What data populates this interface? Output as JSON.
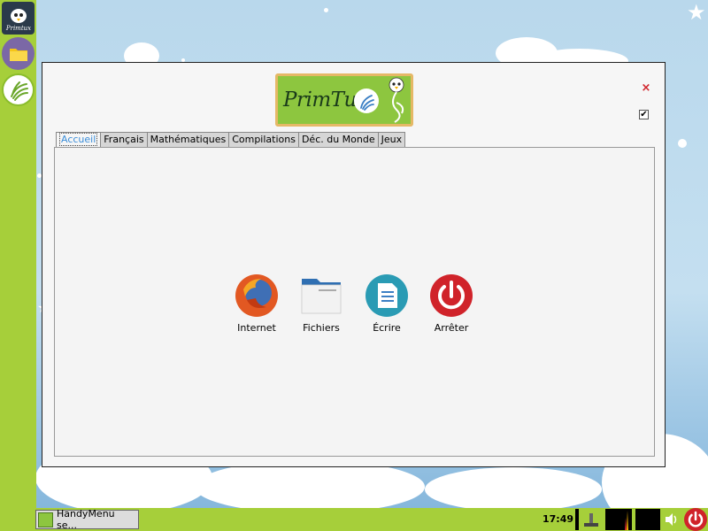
{
  "window": {
    "logo_text": "PrimTux",
    "close_glyph": "×",
    "checkbox_glyph": "✔"
  },
  "tabs": [
    {
      "label": "Accueil",
      "active": true
    },
    {
      "label": "Français",
      "active": false
    },
    {
      "label": "Mathématiques",
      "active": false
    },
    {
      "label": "Compilations",
      "active": false
    },
    {
      "label": "Déc. du Monde",
      "active": false
    },
    {
      "label": "Jeux",
      "active": false
    }
  ],
  "apps": [
    {
      "label": "Internet",
      "icon": "firefox-icon"
    },
    {
      "label": "Fichiers",
      "icon": "folder-icon"
    },
    {
      "label": "Écrire",
      "icon": "document-icon"
    },
    {
      "label": "Arrêter",
      "icon": "power-icon"
    }
  ],
  "launcher": {
    "items": [
      "primtux-logo-icon",
      "files-folder-icon",
      "handymenu-icon"
    ]
  },
  "taskbar": {
    "task_label": "HandyMenu se...",
    "clock": "17:49"
  },
  "colors": {
    "accent_green": "#a6cf3a",
    "active_tab_text": "#3b8dd8",
    "power_red": "#d0232a",
    "firefox_orange": "#e25822",
    "writer_teal": "#2a9bb4"
  }
}
